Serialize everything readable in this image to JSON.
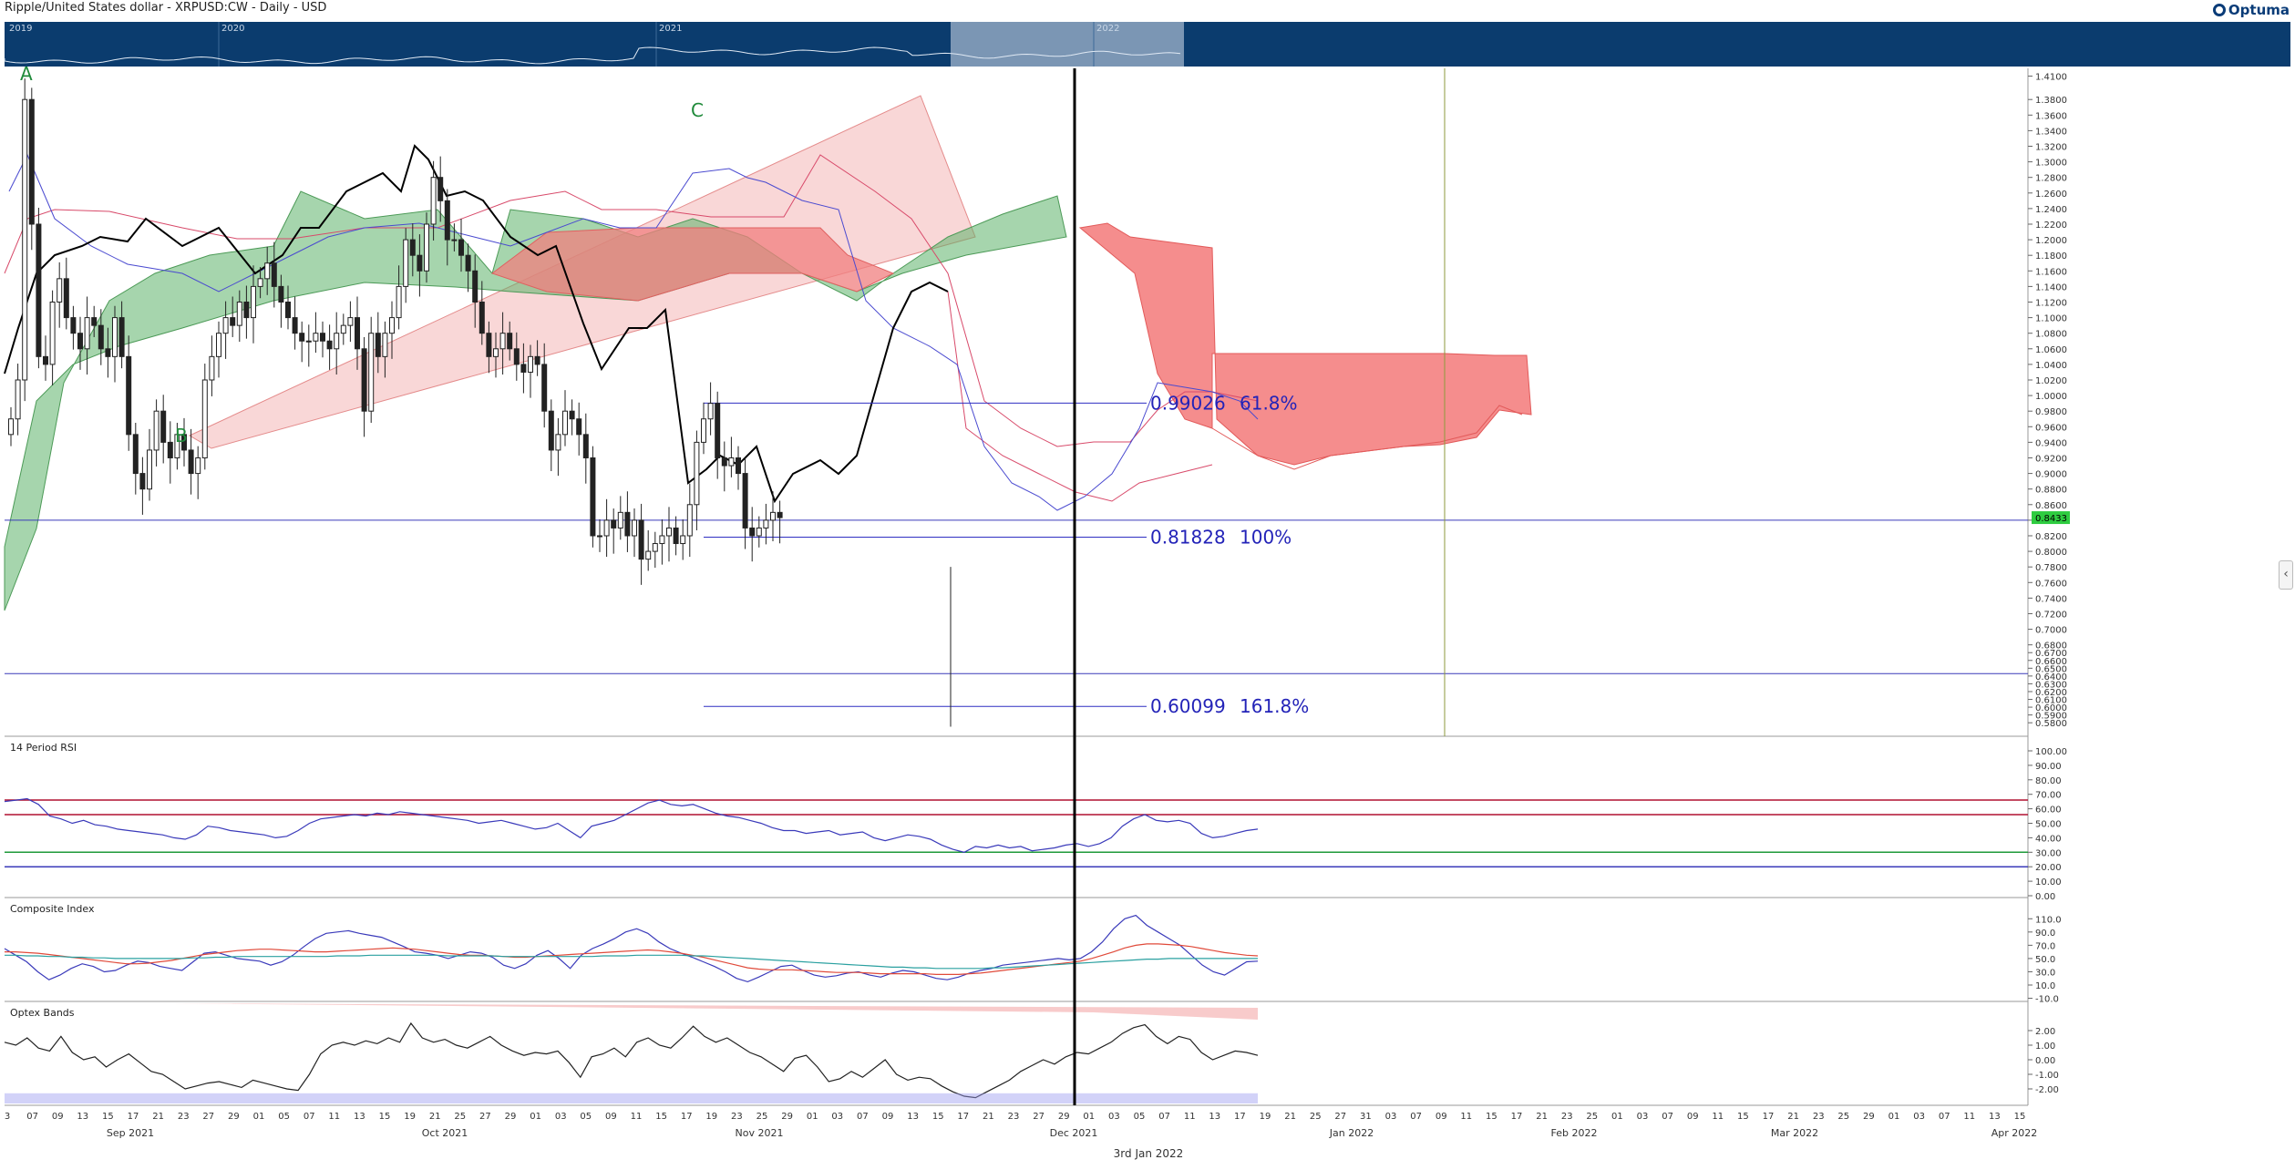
{
  "header": {
    "title": "Ripple/United States dollar - XRPUSD:CW - Daily - USD",
    "logo_text": "Optuma"
  },
  "overview": {
    "years": [
      "2019",
      "2020",
      "2021",
      "2022"
    ]
  },
  "chart_data": [
    {
      "type": "candlestick",
      "title": "Ripple/United States dollar - XRPUSD:CW - Daily - USD",
      "yrange": [
        0.565,
        1.42
      ],
      "y_ticks": [
        1.41,
        1.38,
        1.36,
        1.34,
        1.32,
        1.3,
        1.28,
        1.26,
        1.24,
        1.22,
        1.2,
        1.18,
        1.16,
        1.14,
        1.12,
        1.1,
        1.08,
        1.06,
        1.04,
        1.02,
        1.0,
        0.98,
        0.96,
        0.94,
        0.92,
        0.9,
        0.88,
        0.86,
        0.84,
        0.82,
        0.8,
        0.78,
        0.76,
        0.74,
        0.72,
        0.7,
        0.68,
        0.67,
        0.66,
        0.65,
        0.64,
        0.63,
        0.62,
        0.61,
        0.6,
        0.59,
        0.58
      ],
      "last_price": "0.8433",
      "pattern_labels": [
        "A",
        "B",
        "C"
      ],
      "fib_levels": [
        {
          "price": "0.99026",
          "pct": "61.8%",
          "value": 0.99026
        },
        {
          "price": "0.81828",
          "pct": "100%",
          "value": 0.81828
        },
        {
          "price": "0.60099",
          "pct": "161.8%",
          "value": 0.60099
        }
      ],
      "horizontal_lines": [
        0.84,
        0.643
      ],
      "candles_close": [
        0.97,
        1.02,
        1.38,
        1.22,
        1.05,
        1.04,
        1.12,
        1.15,
        1.1,
        1.08,
        1.06,
        1.1,
        1.09,
        1.06,
        1.05,
        1.1,
        1.05,
        0.95,
        0.9,
        0.88,
        0.93,
        0.98,
        0.94,
        0.92,
        0.95,
        0.93,
        0.9,
        0.92,
        1.02,
        1.05,
        1.08,
        1.1,
        1.09,
        1.12,
        1.1,
        1.14,
        1.15,
        1.17,
        1.14,
        1.12,
        1.1,
        1.08,
        1.07,
        1.07,
        1.08,
        1.07,
        1.06,
        1.08,
        1.09,
        1.1,
        1.06,
        0.98,
        1.08,
        1.05,
        1.08,
        1.1,
        1.14,
        1.2,
        1.18,
        1.16,
        1.22,
        1.28,
        1.25,
        1.2,
        1.2,
        1.18,
        1.16,
        1.12,
        1.08,
        1.05,
        1.06,
        1.08,
        1.06,
        1.04,
        1.03,
        1.05,
        1.04,
        0.98,
        0.93,
        0.95,
        0.98,
        0.97,
        0.95,
        0.92,
        0.82,
        0.82,
        0.84,
        0.83,
        0.85,
        0.82,
        0.84,
        0.79,
        0.8,
        0.81,
        0.82,
        0.83,
        0.81,
        0.82,
        0.86,
        0.94,
        0.97,
        0.99,
        0.92,
        0.91,
        0.92,
        0.9,
        0.83,
        0.82,
        0.83,
        0.84,
        0.85,
        0.8433
      ],
      "time_labels": [
        "3",
        "07",
        "09",
        "13",
        "15",
        "17",
        "21",
        "23",
        "27",
        "29",
        "01",
        "05",
        "07",
        "11",
        "13",
        "15",
        "19",
        "21",
        "25",
        "27",
        "29",
        "01",
        "03",
        "05",
        "09",
        "11",
        "15",
        "17",
        "19",
        "23",
        "25",
        "29",
        "01",
        "03",
        "07",
        "09",
        "13",
        "15",
        "17",
        "21",
        "23",
        "27",
        "29",
        "01",
        "03",
        "05",
        "07",
        "11",
        "13",
        "17",
        "19",
        "21",
        "25",
        "27",
        "31",
        "03",
        "07",
        "09",
        "11",
        "15",
        "17",
        "21",
        "23",
        "25",
        "01",
        "03",
        "07",
        "09",
        "11",
        "15",
        "17",
        "21",
        "23",
        "25",
        "29",
        "01",
        "03",
        "07",
        "11",
        "13",
        "15"
      ],
      "month_labels": [
        "Sep 2021",
        "Oct 2021",
        "Nov 2021",
        "Dec 2021",
        "Jan 2022",
        "Feb 2022",
        "Mar 2022",
        "Apr 2022"
      ],
      "cursor_label": "3rd Jan 2022"
    },
    {
      "type": "line",
      "title": "14 Period RSI",
      "yrange": [
        0,
        100
      ],
      "y_ticks": [
        "100.00",
        "90.00",
        "80.00",
        "70.00",
        "60.00",
        "50.00",
        "40.00",
        "30.00",
        "20.00",
        "10.00",
        "0.00"
      ],
      "levels": [
        66,
        56,
        30,
        20
      ],
      "values": [
        65,
        66,
        67,
        63,
        55,
        53,
        50,
        52,
        49,
        48,
        46,
        45,
        44,
        43,
        42,
        40,
        39,
        42,
        48,
        47,
        45,
        44,
        43,
        42,
        40,
        41,
        45,
        50,
        53,
        54,
        55,
        56,
        55,
        57,
        56,
        58,
        57,
        56,
        55,
        54,
        53,
        52,
        50,
        51,
        52,
        50,
        48,
        46,
        47,
        50,
        45,
        40,
        48,
        50,
        52,
        56,
        60,
        64,
        66,
        63,
        62,
        63,
        60,
        57,
        55,
        54,
        52,
        50,
        47,
        45,
        45,
        43,
        44,
        45,
        42,
        43,
        44,
        40,
        38,
        40,
        42,
        41,
        39,
        35,
        32,
        30,
        34,
        33,
        35,
        33,
        34,
        31,
        32,
        33,
        35,
        36,
        34,
        36,
        40,
        48,
        53,
        56,
        52,
        51,
        52,
        50,
        43,
        40,
        41,
        43,
        45,
        46
      ]
    },
    {
      "type": "line",
      "title": "Composite Index",
      "yrange": [
        -12,
        120
      ],
      "y_ticks": [
        "110.0",
        "90.0",
        "70.0",
        "50.0",
        "30.0",
        "10.0",
        "-10.0"
      ],
      "series": [
        {
          "values": [
            65,
            55,
            45,
            30,
            18,
            25,
            35,
            42,
            38,
            30,
            32,
            40,
            46,
            44,
            38,
            35,
            32,
            45,
            58,
            60,
            55,
            50,
            48,
            46,
            40,
            45,
            55,
            68,
            80,
            88,
            90,
            92,
            88,
            85,
            82,
            75,
            68,
            60,
            58,
            55,
            50,
            55,
            60,
            58,
            52,
            40,
            35,
            42,
            55,
            62,
            50,
            35,
            55,
            65,
            72,
            80,
            90,
            95,
            88,
            75,
            65,
            58,
            52,
            45,
            38,
            30,
            20,
            15,
            22,
            30,
            38,
            40,
            32,
            25,
            22,
            24,
            28,
            30,
            25,
            22,
            28,
            32,
            30,
            25,
            20,
            18,
            22,
            28,
            32,
            35,
            40,
            42,
            44,
            46,
            48,
            50,
            48,
            50,
            60,
            75,
            95,
            110,
            115,
            100,
            90,
            80,
            70,
            55,
            40,
            30,
            25,
            35,
            45,
            46
          ]
        },
        {
          "values": [
            60,
            60,
            59,
            58,
            56,
            54,
            52,
            50,
            48,
            46,
            44,
            42,
            42,
            43,
            45,
            47,
            50,
            53,
            56,
            58,
            60,
            62,
            63,
            64,
            64,
            63,
            62,
            61,
            60,
            60,
            61,
            62,
            63,
            64,
            65,
            66,
            65,
            64,
            62,
            60,
            58,
            56,
            55,
            55,
            54,
            53,
            52,
            52,
            53,
            54,
            55,
            56,
            57,
            58,
            59,
            60,
            61,
            62,
            63,
            62,
            60,
            58,
            55,
            52,
            48,
            44,
            40,
            36,
            34,
            33,
            33,
            33,
            32,
            31,
            30,
            29,
            29,
            29,
            28,
            27,
            27,
            27,
            27,
            27,
            26,
            26,
            26,
            27,
            28,
            30,
            32,
            34,
            36,
            38,
            40,
            42,
            44,
            46,
            50,
            55,
            60,
            66,
            70,
            72,
            72,
            71,
            70,
            68,
            65,
            62,
            59,
            57,
            55,
            54
          ]
        },
        {
          "values": [
            55,
            55,
            54,
            54,
            53,
            53,
            52,
            52,
            51,
            51,
            50,
            50,
            50,
            50,
            50,
            50,
            50,
            51,
            51,
            52,
            52,
            53,
            53,
            53,
            53,
            53,
            53,
            53,
            53,
            53,
            54,
            54,
            54,
            55,
            55,
            55,
            55,
            55,
            55,
            55,
            54,
            54,
            54,
            54,
            54,
            53,
            53,
            53,
            53,
            53,
            53,
            53,
            53,
            53,
            54,
            54,
            54,
            55,
            55,
            55,
            55,
            55,
            54,
            54,
            53,
            52,
            51,
            50,
            49,
            48,
            47,
            46,
            45,
            44,
            43,
            42,
            41,
            40,
            39,
            38,
            37,
            37,
            36,
            36,
            35,
            35,
            35,
            35,
            35,
            36,
            36,
            37,
            38,
            39,
            40,
            41,
            42,
            43,
            44,
            45,
            46,
            47,
            48,
            49,
            49,
            50,
            50,
            50,
            50,
            50,
            50,
            50,
            50,
            50
          ]
        }
      ]
    },
    {
      "type": "line",
      "title": "Optex Bands",
      "yrange": [
        -3,
        3
      ],
      "y_ticks": [
        "2.00",
        "1.00",
        "0.00",
        "-1.00",
        "-2.00"
      ],
      "values": [
        1.2,
        1.0,
        1.5,
        0.8,
        0.6,
        1.6,
        0.5,
        0.0,
        0.2,
        -0.5,
        0.0,
        0.4,
        -0.2,
        -0.8,
        -1.0,
        -1.5,
        -2.0,
        -1.8,
        -1.6,
        -1.5,
        -1.7,
        -1.9,
        -1.4,
        -1.6,
        -1.8,
        -2.0,
        -2.1,
        -1.0,
        0.4,
        1.0,
        1.2,
        1.0,
        1.3,
        1.1,
        1.5,
        1.2,
        2.5,
        1.5,
        1.2,
        1.4,
        1.0,
        0.8,
        1.2,
        1.6,
        1.0,
        0.6,
        0.3,
        0.5,
        0.4,
        0.6,
        -0.2,
        -1.2,
        0.2,
        0.4,
        0.8,
        0.2,
        1.2,
        1.5,
        1.0,
        0.8,
        1.5,
        2.3,
        1.6,
        1.2,
        1.5,
        1.0,
        0.5,
        0.2,
        -0.3,
        -0.8,
        0.1,
        0.3,
        -0.5,
        -1.5,
        -1.3,
        -0.8,
        -1.2,
        -0.6,
        0.0,
        -1.0,
        -1.4,
        -1.2,
        -1.3,
        -1.8,
        -2.2,
        -2.5,
        -2.6,
        -2.2,
        -1.8,
        -1.4,
        -0.8,
        -0.4,
        0.0,
        -0.3,
        0.2,
        0.5,
        0.4,
        0.8,
        1.2,
        1.8,
        2.2,
        2.4,
        1.6,
        1.1,
        1.6,
        1.4,
        0.5,
        0.0,
        0.3,
        0.6,
        0.5,
        0.3
      ]
    }
  ]
}
